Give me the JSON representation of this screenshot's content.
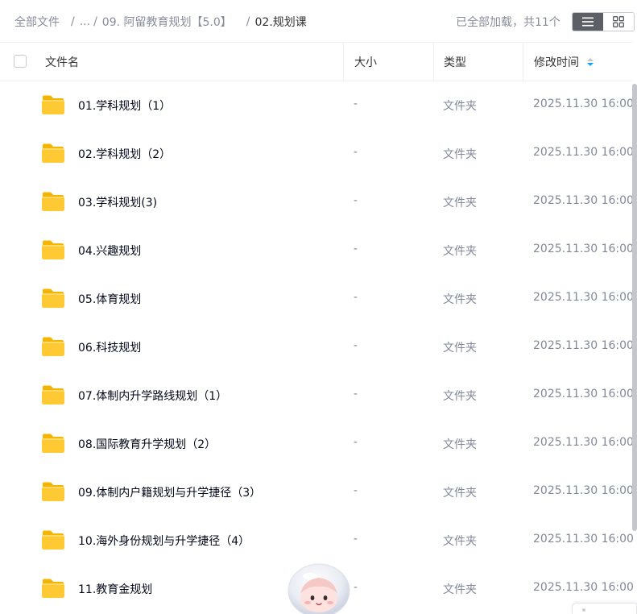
{
  "breadcrumb": {
    "root": "全部文件",
    "ellipsis": "...",
    "parent": "09. 阿留教育规划【5.0】",
    "current": "02.规划课"
  },
  "status": {
    "loaded_text": "已全部加载，共11个"
  },
  "view_toggle": {
    "list_icon": "list-icon",
    "grid_icon": "grid-icon",
    "active": "list"
  },
  "columns": {
    "name": "文件名",
    "size": "大小",
    "type": "类型",
    "modified": "修改时间",
    "sort_direction": "descending"
  },
  "colors": {
    "accent": "#06a7ff",
    "folder": "#ffc933",
    "folder_tab": "#f5b400",
    "active_toggle": "#5c5f66"
  },
  "files": [
    {
      "name": "01.学科规划（1）",
      "size": "-",
      "type": "文件夹",
      "modified": "2025.11.30 16:00"
    },
    {
      "name": "02.学科规划（2）",
      "size": "-",
      "type": "文件夹",
      "modified": "2025.11.30 16:00"
    },
    {
      "name": "03.学科规划(3)",
      "size": "-",
      "type": "文件夹",
      "modified": "2025.11.30 16:00"
    },
    {
      "name": "04.兴趣规划",
      "size": "-",
      "type": "文件夹",
      "modified": "2025.11.30 16:00"
    },
    {
      "name": "05.体育规划",
      "size": "-",
      "type": "文件夹",
      "modified": "2025.11.30 16:00"
    },
    {
      "name": "06.科技规划",
      "size": "-",
      "type": "文件夹",
      "modified": "2025.11.30 16:00"
    },
    {
      "name": "07.体制内升学路线规划（1）",
      "size": "-",
      "type": "文件夹",
      "modified": "2025.11.30 16:00"
    },
    {
      "name": "08.国际教育升学规划（2）",
      "size": "-",
      "type": "文件夹",
      "modified": "2025.11.30 16:00"
    },
    {
      "name": "09.体制内户籍规划与升学捷径（3）",
      "size": "-",
      "type": "文件夹",
      "modified": "2025.11.30 16:00"
    },
    {
      "name": "10.海外身份规划与升学捷径（4）",
      "size": "-",
      "type": "文件夹",
      "modified": "2025.11.30 16:00"
    },
    {
      "name": "11.教育金规划",
      "size": "-",
      "type": "文件夹",
      "modified": "2025.11.30 16:00"
    }
  ]
}
